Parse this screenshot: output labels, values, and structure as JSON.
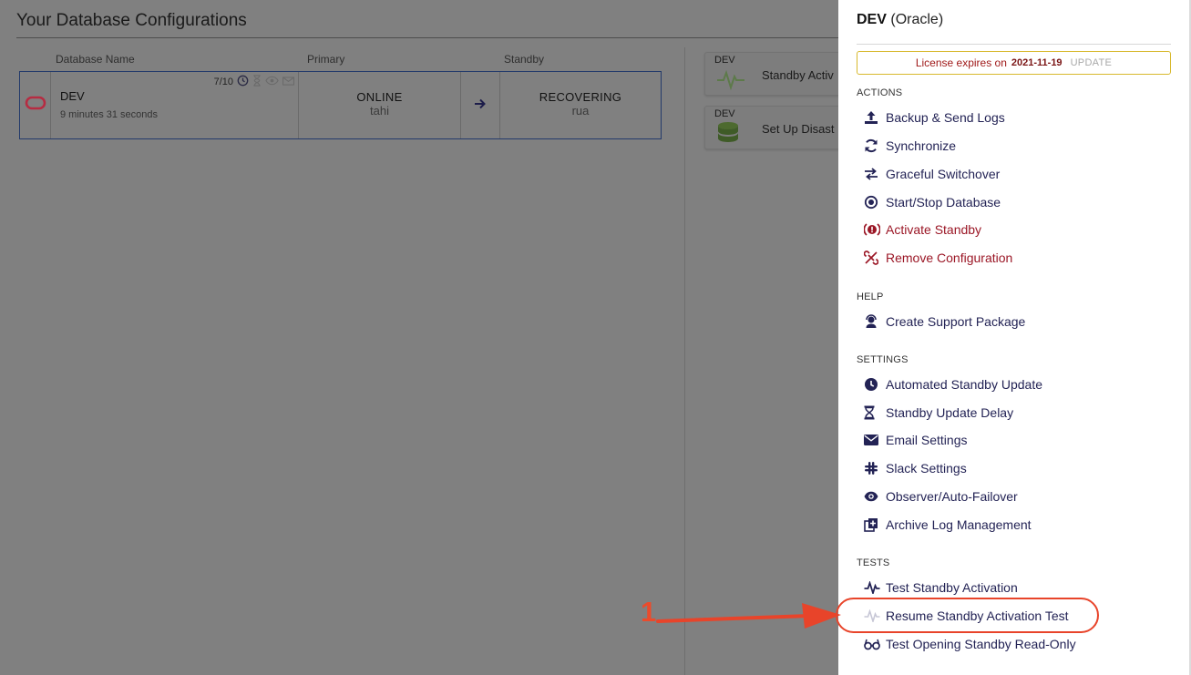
{
  "page": {
    "title": "Your Database Configurations",
    "columns": [
      "Database Name",
      "Primary",
      "Standby"
    ]
  },
  "database": {
    "name": "DEV",
    "elapsed": "9 minutes 31 seconds",
    "stats": "7/10",
    "primary_state": "ONLINE",
    "primary_host": "tahi",
    "standby_state": "RECOVERING",
    "standby_host": "rua"
  },
  "side_cards": [
    {
      "tag": "DEV",
      "label": "Standby Activ",
      "icon": "pulse-icon"
    },
    {
      "tag": "DEV",
      "label": "Set Up Disast",
      "icon": "database-icon"
    }
  ],
  "panel": {
    "db_name": "DEV",
    "db_type": "(Oracle)",
    "license_text": "License expires on",
    "license_date": "2021-11-19",
    "license_update": "UPDATE",
    "sections": {
      "actions": "ACTIONS",
      "help": "HELP",
      "settings": "SETTINGS",
      "tests": "TESTS"
    },
    "actions": [
      {
        "label": "Backup & Send Logs",
        "icon": "upload-icon"
      },
      {
        "label": "Synchronize",
        "icon": "sync-icon"
      },
      {
        "label": "Graceful Switchover",
        "icon": "switch-icon"
      },
      {
        "label": "Start/Stop Database",
        "icon": "record-icon"
      },
      {
        "label": "Activate Standby",
        "icon": "alert-icon"
      },
      {
        "label": "Remove Configuration",
        "icon": "unlink-icon"
      }
    ],
    "help": [
      {
        "label": "Create Support Package",
        "icon": "support-icon"
      }
    ],
    "settings": [
      {
        "label": "Automated Standby Update",
        "icon": "clock-icon"
      },
      {
        "label": "Standby Update Delay",
        "icon": "hourglass-icon"
      },
      {
        "label": "Email Settings",
        "icon": "envelope-icon"
      },
      {
        "label": "Slack Settings",
        "icon": "slack-icon"
      },
      {
        "label": "Observer/Auto-Failover",
        "icon": "eye-icon"
      },
      {
        "label": "Archive Log Management",
        "icon": "archive-icon"
      }
    ],
    "tests": [
      {
        "label": "Test Standby Activation",
        "icon": "pulse-icon"
      },
      {
        "label": "Resume Standby Activation Test",
        "icon": "pulse-faded-icon"
      },
      {
        "label": "Test Opening Standby Read-Only",
        "icon": "glasses-icon"
      }
    ]
  },
  "annotation": {
    "number": "1"
  },
  "colors": {
    "navy": "#232355",
    "danger": "#9b1726",
    "license_border": "#d8b92e",
    "callout": "#e8442a"
  }
}
